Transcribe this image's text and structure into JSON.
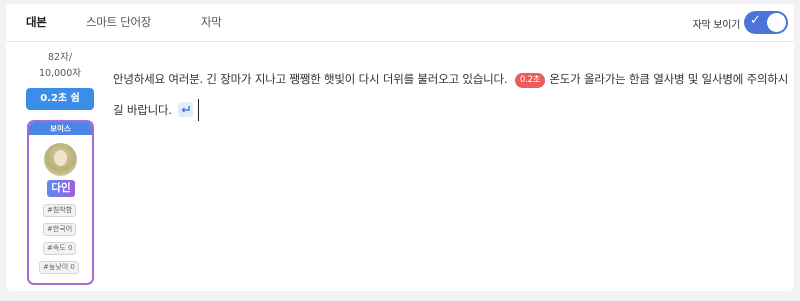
{
  "tabs": [
    {
      "label": "대본"
    },
    {
      "label": "스마트 단어장"
    },
    {
      "label": "자막"
    }
  ],
  "subtitle_toggle": {
    "label": "자막 보이기",
    "checked": true,
    "color": "#4a74d8"
  },
  "char_count": {
    "used": "82자/",
    "limit": "10,000자"
  },
  "pause_button": {
    "label": "0.2초 쉼",
    "color": "#3b8ee8"
  },
  "voice": {
    "header": "보이스",
    "name": "다인",
    "tags": [
      "#침착함",
      "#한국어",
      "#속도 0",
      "#높낮이 0"
    ],
    "border_color": "#a86ad8"
  },
  "script": {
    "text_before_pause": "안녕하세요 여러분. 긴 장마가 지나고 쨍쨍한 햇빛이 다시 더위를 불러오고 있습니다.",
    "pause_chip": "0.2초",
    "text_after_pause": "온도가 올라가는 한큼 열사병 및 일사병에 주의하시길 바랍니다."
  },
  "icons": {
    "enter": "return-arrow-icon",
    "toggle_check": "check-icon"
  }
}
